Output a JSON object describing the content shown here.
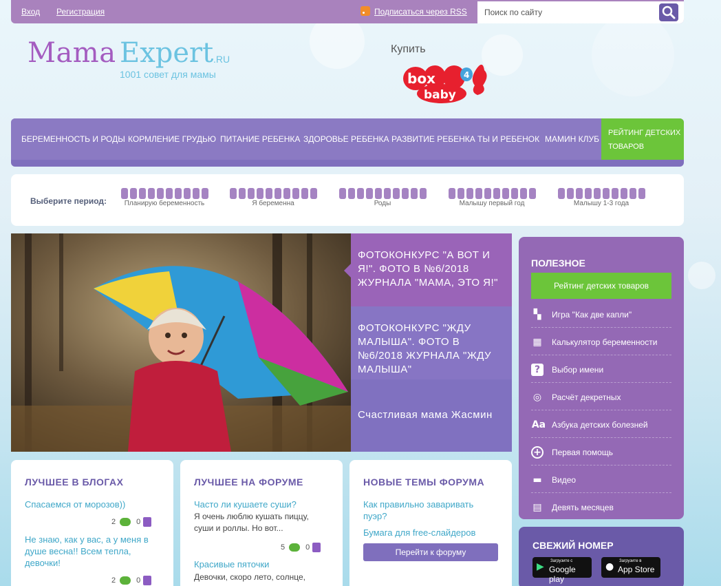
{
  "topbar": {
    "login": "Вход",
    "register": "Регистрация",
    "rss": "Подписаться через RSS",
    "search_placeholder": "Поиск по сайту"
  },
  "logo": {
    "part1": "Mama",
    "part2": "Expert",
    "suffix": ".RU",
    "tagline": "1001 совет для мамы"
  },
  "promo": {
    "buy": "Купить",
    "brand_top": "box",
    "brand_num": "4",
    "brand_bottom": "baby"
  },
  "nav": {
    "items": [
      "БЕРЕМЕННОСТЬ И РОДЫ",
      "КОРМЛЕНИЕ ГРУДЬЮ",
      "ПИТАНИЕ РЕБЕНКА",
      "ЗДОРОВЬЕ РЕБЕНКА",
      "РАЗВИТИЕ РЕБЕНКА",
      "ТЫ И РЕБЕНОК",
      "МАМИН КЛУБ"
    ],
    "highlight": "РЕЙТИНГ ДЕТСКИХ ТОВАРОВ"
  },
  "period": {
    "label": "Выберите период:",
    "options": [
      "Планирую беременность",
      "Я беременна",
      "Роды",
      "Малышу первый год",
      "Малышу 1-3 года"
    ]
  },
  "slides": [
    {
      "title": "ФОТОКОНКУРС \"А ВОТ И Я!\". ФОТО В №6/2018 ЖУРНАЛА \"МАМА, ЭТО Я!\""
    },
    {
      "title": "ФОТОКОНКУРС \"ЖДУ МАЛЫША\". ФОТО В №6/2018 ЖУРНАЛА \"ЖДУ МАЛЫША\""
    },
    {
      "title": "Счастливая мама Жасмин"
    }
  ],
  "sidebar": {
    "title": "ПОЛЕЗНОЕ",
    "button": "Рейтинг детских товаров",
    "items": [
      {
        "label": "Игра \"Как две капли\"",
        "icon": "puzzle-icon"
      },
      {
        "label": "Калькулятор беременности",
        "icon": "calculator-icon"
      },
      {
        "label": "Выбор имени",
        "icon": "question-icon"
      },
      {
        "label": "Расчёт декретных",
        "icon": "coins-icon"
      },
      {
        "label": "Азбука детских болезней",
        "icon": "alphabet-icon"
      },
      {
        "label": "Первая помощь",
        "icon": "plus-icon"
      },
      {
        "label": "Видео",
        "icon": "clapper-icon"
      },
      {
        "label": "Девять месяцев",
        "icon": "calendar-icon"
      }
    ]
  },
  "fresh": {
    "title": "СВЕЖИЙ НОМЕР",
    "google_small": "Загрузите с",
    "google_big": "Google play",
    "apple_small": "Загрузите в",
    "apple_big": "App Store"
  },
  "cards": {
    "blogs": {
      "title": "ЛУЧШЕЕ В БЛОГАХ",
      "posts": [
        {
          "title": "Спасаемся от морозов))",
          "comments": "2",
          "likes": "0"
        },
        {
          "title": "Не знаю, как у вас, а у меня в душе весна!! Всем тепла, девочки!",
          "comments": "2",
          "likes": "0"
        }
      ]
    },
    "forum": {
      "title": "ЛУЧШЕЕ НА ФОРУМЕ",
      "posts": [
        {
          "title": "Часто ли кушаете суши?",
          "excerpt": "Я очень люблю кушать пиццу, суши и роллы. Но вот...",
          "comments": "5",
          "likes": "0"
        },
        {
          "title": "Красивые пяточки",
          "excerpt": "Девочки, скоро лето, солнце,"
        }
      ]
    },
    "new_topics": {
      "title": "НОВЫЕ ТЕМЫ ФОРУМА",
      "topics": [
        "Как правильно заваривать пуэр?",
        "Бумага для free-слайдеров"
      ],
      "button": "Перейти к форуму"
    }
  },
  "colors": {
    "accent_purple": "#9469b5",
    "nav_purple": "#8b7ac3",
    "green": "#6cc53a",
    "link_blue": "#3fa7c8"
  }
}
